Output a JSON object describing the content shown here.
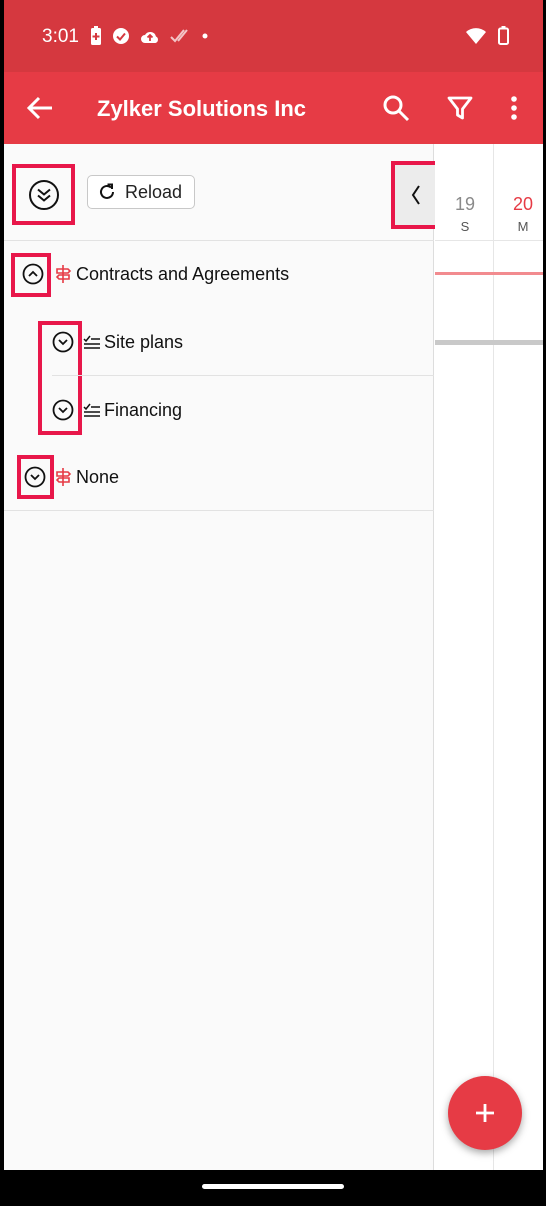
{
  "status_bar": {
    "time": "3:01"
  },
  "app_bar": {
    "title": "Zylker Solutions Inc"
  },
  "toolbar": {
    "reload_label": "Reload"
  },
  "tree": {
    "items": [
      {
        "label": "Contracts and Agreements"
      },
      {
        "label": "Site plans"
      },
      {
        "label": "Financing"
      },
      {
        "label": "None"
      }
    ]
  },
  "calendar": {
    "days": [
      {
        "num": "19",
        "letter": "S"
      },
      {
        "num": "20",
        "letter": "M"
      }
    ]
  },
  "colors": {
    "status_bar": "#d5383f",
    "app_bar": "#e63b45",
    "highlight": "#e8174a",
    "milestone_icon": "#e63b45",
    "today": "#e63b45"
  }
}
